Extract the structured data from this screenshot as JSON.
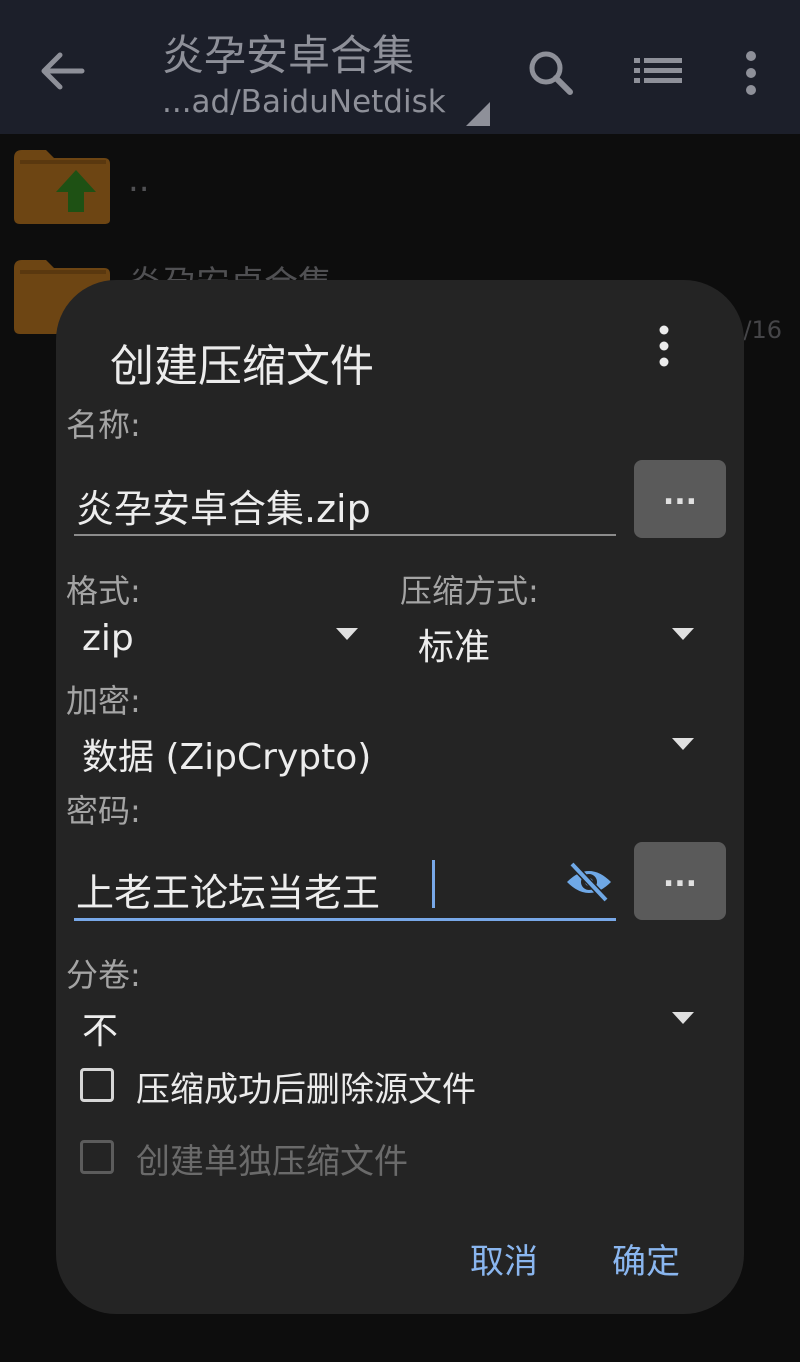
{
  "appbar": {
    "title": "炎孕安卓合集",
    "path": "...ad/BaiduNetdisk"
  },
  "files": [
    {
      "name": "..",
      "meta": ""
    },
    {
      "name": "炎孕安卓合集",
      "meta": "/16"
    }
  ],
  "dialog": {
    "title": "创建压缩文件",
    "name_label": "名称:",
    "name_value": "炎孕安卓合集.zip",
    "browse_label": "...",
    "format_label": "格式:",
    "format_value": "zip",
    "method_label": "压缩方式:",
    "method_value": "标准",
    "encrypt_label": "加密:",
    "encrypt_value": "数据 (ZipCrypto)",
    "password_label": "密码:",
    "password_value": "上老王论坛当老王",
    "password_more_label": "...",
    "split_label": "分卷:",
    "split_value": "不",
    "delete_source_label": "压缩成功后删除源文件",
    "separate_archive_label": "创建单独压缩文件",
    "cancel_label": "取消",
    "ok_label": "确定"
  },
  "colors": {
    "appbar_bg": "#1c1f2a",
    "dialog_bg": "#242424",
    "accent": "#8ab6ef",
    "folder": "#a86a1e",
    "folder_arrow": "#2f7d1f"
  }
}
